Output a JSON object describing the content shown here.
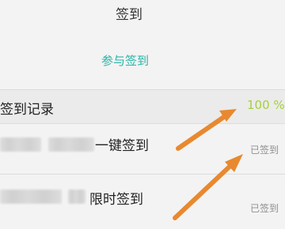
{
  "header": {
    "title": "签到"
  },
  "actions": {
    "join_label": "参与签到"
  },
  "record": {
    "label": "签到记录",
    "value": "100 %"
  },
  "tasks": [
    {
      "name_suffix": "一键签到",
      "status": "已签到"
    },
    {
      "name_suffix": "限时签到",
      "status": "已签到"
    }
  ],
  "annotation": {
    "arrow_color": "#e8892f"
  }
}
